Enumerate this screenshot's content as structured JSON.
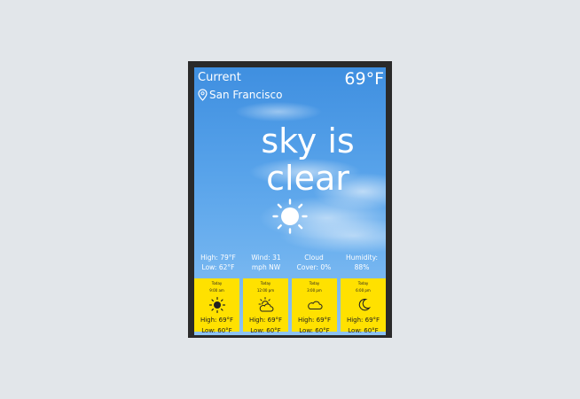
{
  "header": {
    "label": "Current",
    "temperature": "69°F",
    "location": "San Francisco"
  },
  "condition": {
    "line1": "sky is",
    "line2": "clear",
    "icon": "sun-icon"
  },
  "stats": [
    {
      "line1": "High: 79°F",
      "line2": "Low: 62°F"
    },
    {
      "line1": "Wind: 31",
      "line2": "mph NW"
    },
    {
      "line1": "Cloud",
      "line2": "Cover: 0%"
    },
    {
      "line1": "Humidity:",
      "line2": "88%"
    }
  ],
  "forecast": [
    {
      "day": "Today",
      "time": "9:00 am",
      "icon": "sun-icon",
      "high": "High: 69°F",
      "low": "Low: 60°F"
    },
    {
      "day": "Today",
      "time": "12:00 pm",
      "icon": "partly-cloudy-icon",
      "high": "High: 69°F",
      "low": "Low: 60°F"
    },
    {
      "day": "Today",
      "time": "3:00 pm",
      "icon": "cloud-icon",
      "high": "High: 69°F",
      "low": "Low: 60°F"
    },
    {
      "day": "Today",
      "time": "6:00 pm",
      "icon": "moon-icon",
      "high": "High: 69°F",
      "low": "Low: 60°F"
    }
  ],
  "colors": {
    "frame": "#2a2a2a",
    "card": "#ffe100",
    "sky": "#58a3ea"
  }
}
